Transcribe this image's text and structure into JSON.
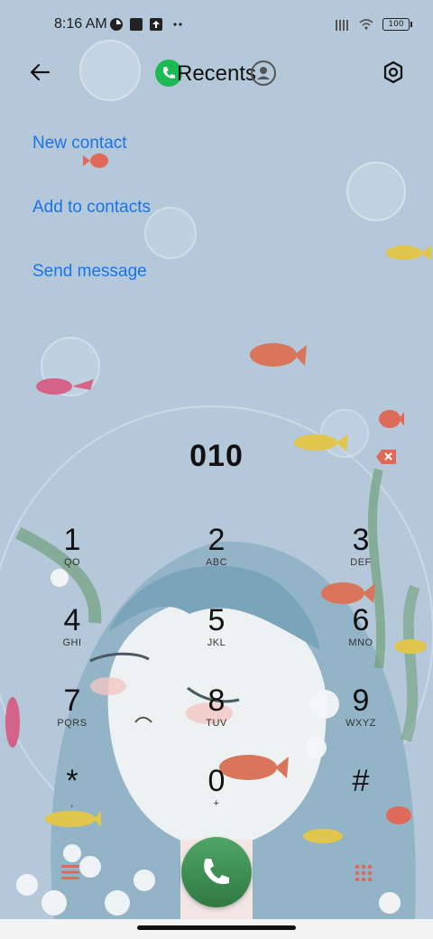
{
  "status_bar": {
    "time": "8:16 AM",
    "battery": "100",
    "icons": [
      "app-icon",
      "square-icon",
      "upload-icon",
      "more-dots-icon",
      "signal-icon",
      "wifi-icon",
      "battery-icon"
    ]
  },
  "header": {
    "title": "Recents",
    "back_icon": "back-arrow-icon",
    "settings_icon": "gear-icon"
  },
  "actions": {
    "new_contact": "New contact",
    "add_to_contacts": "Add to contacts",
    "send_message": "Send message"
  },
  "dialer": {
    "number": "010"
  },
  "keypad": [
    {
      "digit": "1",
      "letters": "QO"
    },
    {
      "digit": "2",
      "letters": "ABC"
    },
    {
      "digit": "3",
      "letters": "DEF"
    },
    {
      "digit": "4",
      "letters": "GHI"
    },
    {
      "digit": "5",
      "letters": "JKL"
    },
    {
      "digit": "6",
      "letters": "MNO"
    },
    {
      "digit": "7",
      "letters": "PQRS"
    },
    {
      "digit": "8",
      "letters": "TUV"
    },
    {
      "digit": "9",
      "letters": "WXYZ"
    },
    {
      "digit": "*",
      "letters": ","
    },
    {
      "digit": "0",
      "letters": "+"
    },
    {
      "digit": "#",
      "letters": ""
    }
  ],
  "colors": {
    "accent": "#1a73e8",
    "call_green": "#3a8c52",
    "badge_green": "#1db954",
    "delete_red": "#e06a5a"
  }
}
